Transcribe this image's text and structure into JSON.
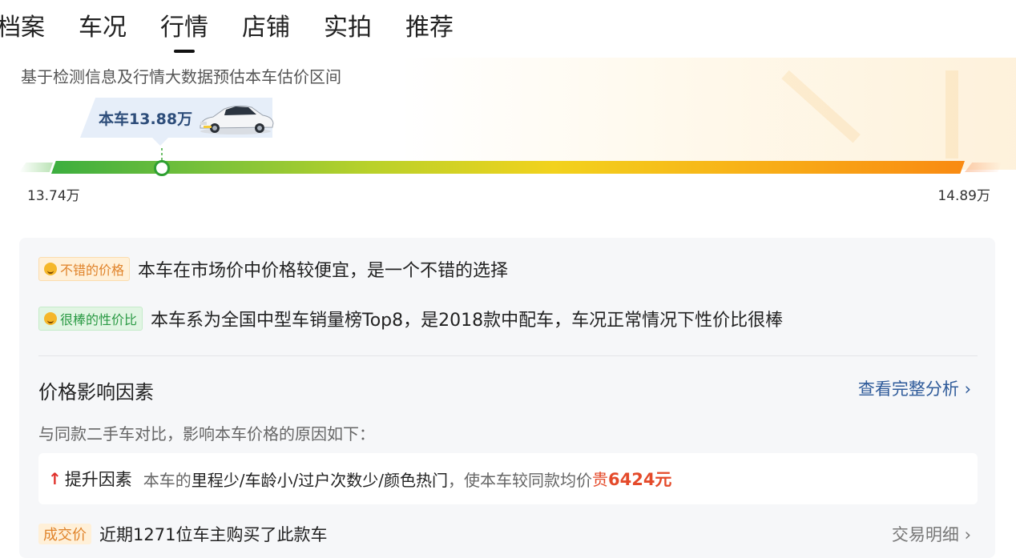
{
  "tabs": [
    {
      "label": "档案",
      "active": false
    },
    {
      "label": "车况",
      "active": false
    },
    {
      "label": "行情",
      "active": true
    },
    {
      "label": "店铺",
      "active": false
    },
    {
      "label": "实拍",
      "active": false
    },
    {
      "label": "推荐",
      "active": false
    }
  ],
  "valuation": {
    "subtitle": "基于检测信息及行情大数据预估本车估价区间",
    "tooltip": "本车13.88万",
    "min_label": "13.74万",
    "max_label": "14.89万",
    "min_value": 13.74,
    "max_value": 14.89,
    "current_value": 13.88
  },
  "insights": [
    {
      "badge": "不错的价格",
      "text": "本车在市场价中价格较便宜，是一个不错的选择"
    },
    {
      "badge": "很棒的性价比",
      "text": "本车系为全国中型车销量榜Top8，是2018款中配车，车况正常情况下性价比很棒"
    }
  ],
  "factors": {
    "title": "价格影响因素",
    "link": "查看完整分析",
    "link_chevron": "›",
    "desc": "与同款二手车对比，影响本车价格的原因如下：",
    "up": {
      "arrow": "↑",
      "label": "提升因素",
      "prefix": "本车的",
      "items": "里程少/车龄小/过户次数少/颜色热门",
      "suffix": "，使本车较同款均价",
      "price_word": "贵",
      "price": "6424元"
    }
  },
  "deal": {
    "badge": "成交价",
    "text": "近期1271位车主购买了此款车",
    "link": "交易明细",
    "chevron": "›"
  },
  "colors": {
    "accent_green": "#2fa032",
    "accent_orange": "#f98a12",
    "link_blue": "#2f5b9a",
    "price_red": "#e44a2a"
  }
}
